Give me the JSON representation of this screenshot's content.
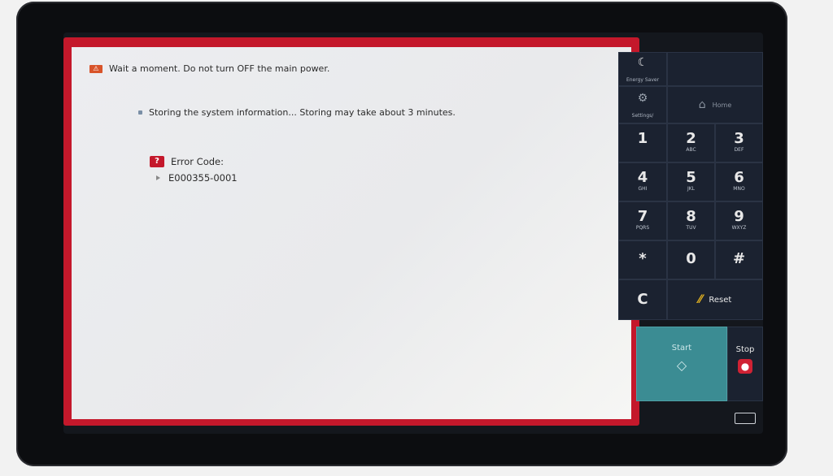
{
  "message": {
    "warning": "Wait a moment. Do not turn OFF the main power.",
    "info": "Storing the system information... Storing may take about 3 minutes.",
    "error_label": "Error Code:",
    "error_code": "E000355-0001"
  },
  "keypad": {
    "energy_saver": "Energy Saver",
    "settings": "Settings/ Registration",
    "home": "Home",
    "keys": [
      {
        "digit": "1",
        "letters": ""
      },
      {
        "digit": "2",
        "letters": "ABC"
      },
      {
        "digit": "3",
        "letters": "DEF"
      },
      {
        "digit": "4",
        "letters": "GHI"
      },
      {
        "digit": "5",
        "letters": "JKL"
      },
      {
        "digit": "6",
        "letters": "MNO"
      },
      {
        "digit": "7",
        "letters": "PQRS"
      },
      {
        "digit": "8",
        "letters": "TUV"
      },
      {
        "digit": "9",
        "letters": "WXYZ"
      },
      {
        "digit": "*",
        "letters": ""
      },
      {
        "digit": "0",
        "letters": ""
      },
      {
        "digit": "#",
        "letters": ""
      }
    ],
    "clear": "C",
    "reset": "Reset",
    "start": "Start",
    "stop": "Stop"
  },
  "colors": {
    "frame_red": "#c4182b",
    "start_teal": "#3b8c93"
  }
}
